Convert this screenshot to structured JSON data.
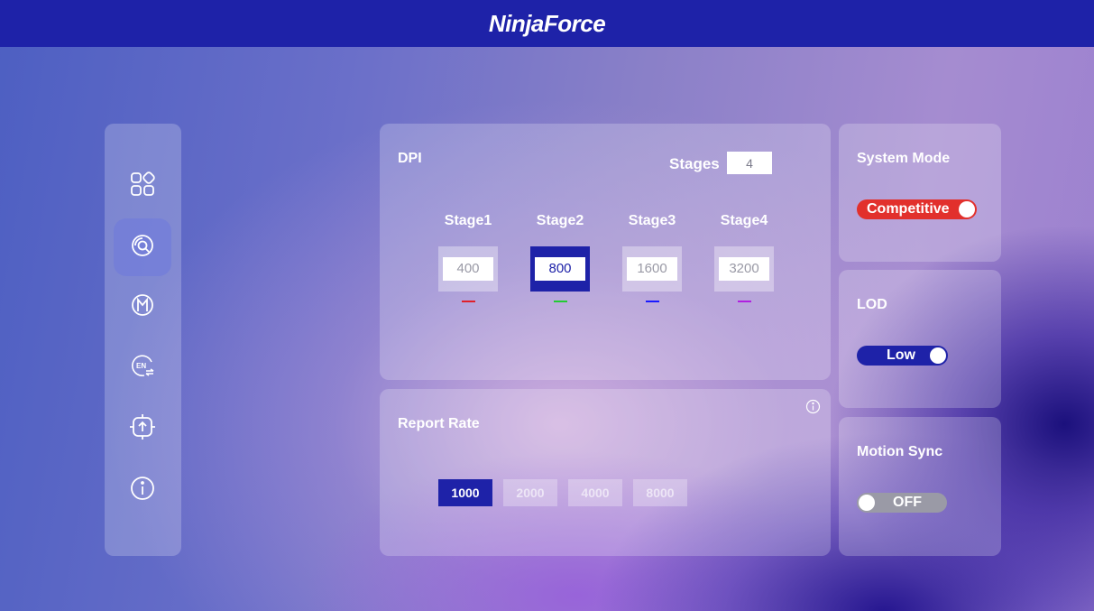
{
  "header": {
    "logo": "NinjaForce"
  },
  "sidebar": {
    "items": [
      {
        "name": "overview",
        "icon": "apps-grid-icon"
      },
      {
        "name": "sensor",
        "icon": "sensor-icon",
        "active": true
      },
      {
        "name": "macro",
        "icon": "macro-icon"
      },
      {
        "name": "language",
        "icon": "language-en-icon"
      },
      {
        "name": "firmware",
        "icon": "firmware-upgrade-icon"
      },
      {
        "name": "about",
        "icon": "info-icon"
      }
    ]
  },
  "dpi": {
    "title": "DPI",
    "stages_label": "Stages",
    "stages_value": "4",
    "stages": [
      {
        "label": "Stage1",
        "value": "400",
        "color": "#e0202a",
        "active": false
      },
      {
        "label": "Stage2",
        "value": "800",
        "color": "#22cc33",
        "active": true
      },
      {
        "label": "Stage3",
        "value": "1600",
        "color": "#1a1aff",
        "active": false
      },
      {
        "label": "Stage4",
        "value": "3200",
        "color": "#b020e0",
        "active": false
      }
    ]
  },
  "report_rate": {
    "title": "Report Rate",
    "options": [
      "1000",
      "2000",
      "4000",
      "8000"
    ],
    "selected": "1000"
  },
  "system_mode": {
    "title": "System Mode",
    "value": "Competitive",
    "on": true,
    "color": "#e2302c"
  },
  "lod": {
    "title": "LOD",
    "value": "Low",
    "on": true,
    "color": "#1e22a8"
  },
  "motion_sync": {
    "title": "Motion Sync",
    "value": "OFF",
    "on": false,
    "color": "#9a9aa6"
  },
  "colors": {
    "accent": "#1e22a8",
    "topbar": "#1e22a8"
  }
}
